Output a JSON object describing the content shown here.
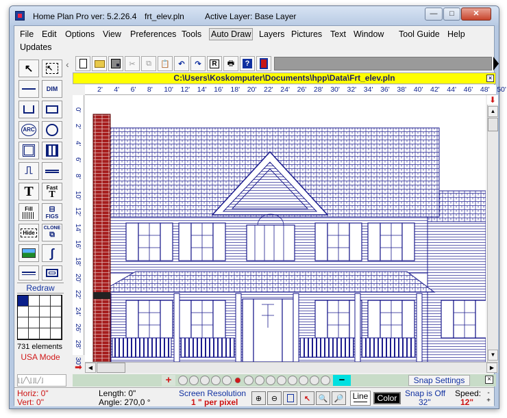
{
  "window": {
    "app_title": "Home Plan Pro ver: 5.2.26.4",
    "file_name": "frt_elev.pln",
    "active_layer": "Active Layer: Base Layer",
    "minimize": "—",
    "maximize": "□",
    "close": "✕"
  },
  "menu": {
    "row1": [
      "File",
      "Edit",
      "Options",
      "View",
      "Preferences",
      "Tools",
      "Auto Draw",
      "Layers",
      "Pictures",
      "Text",
      "Window",
      "Tool Guide",
      "Help"
    ],
    "row2": [
      "Updates"
    ]
  },
  "left_tools": {
    "dim_label": "DIM",
    "arc_label": "ARC",
    "text_label": "T",
    "fast_label": "Fast",
    "fill_label": "Fill",
    "figs_label": "FIGS",
    "hide_label": "Hide",
    "clone_label": "CLONE",
    "redraw": "Redraw",
    "elements": "731 elements",
    "usa_mode": "USA Mode"
  },
  "top_tools": {
    "print_label": "R"
  },
  "path_bar": {
    "path": "C:\\Users\\Koskomputer\\Documents\\hpp\\Data\\Frt_elev.pln",
    "close": "×"
  },
  "rulers": {
    "horizontal": [
      "2'",
      "4'",
      "6'",
      "8'",
      "10'",
      "12'",
      "14'",
      "16'",
      "18'",
      "20'",
      "22'",
      "24'",
      "26'",
      "28'",
      "30'",
      "32'",
      "34'",
      "36'",
      "38'",
      "40'",
      "42'",
      "44'",
      "46'",
      "48'",
      "50'"
    ],
    "vertical": [
      "0'",
      "2'",
      "4'",
      "6'",
      "8'",
      "10'",
      "12'",
      "14'",
      "16'",
      "18'",
      "20'",
      "22'",
      "24'",
      "26'",
      "28'",
      "30'"
    ]
  },
  "layer_bar": {
    "plus": "+",
    "minus": "−",
    "snap_settings": "Snap Settings",
    "close": "×"
  },
  "status": {
    "horiz": "Horiz: 0\"",
    "vert": "Vert:  0\"",
    "length": "Length:  0\"",
    "angle": "Angle:  270,0 °",
    "screen_res_label": "Screen Resolution",
    "screen_res_value": "1 \" per pixel",
    "line_label": "Line",
    "color_label": "Color",
    "snap_label": "Snap is Off",
    "snap_value": "32\"",
    "speed_label": "Speed:",
    "speed_value": "12\""
  },
  "colors": {
    "drawing": "#1a1a8c",
    "brick": "#a61e1e",
    "path_bg": "#ffff00",
    "status_red": "#cc1111",
    "status_blue": "#1030a0"
  }
}
